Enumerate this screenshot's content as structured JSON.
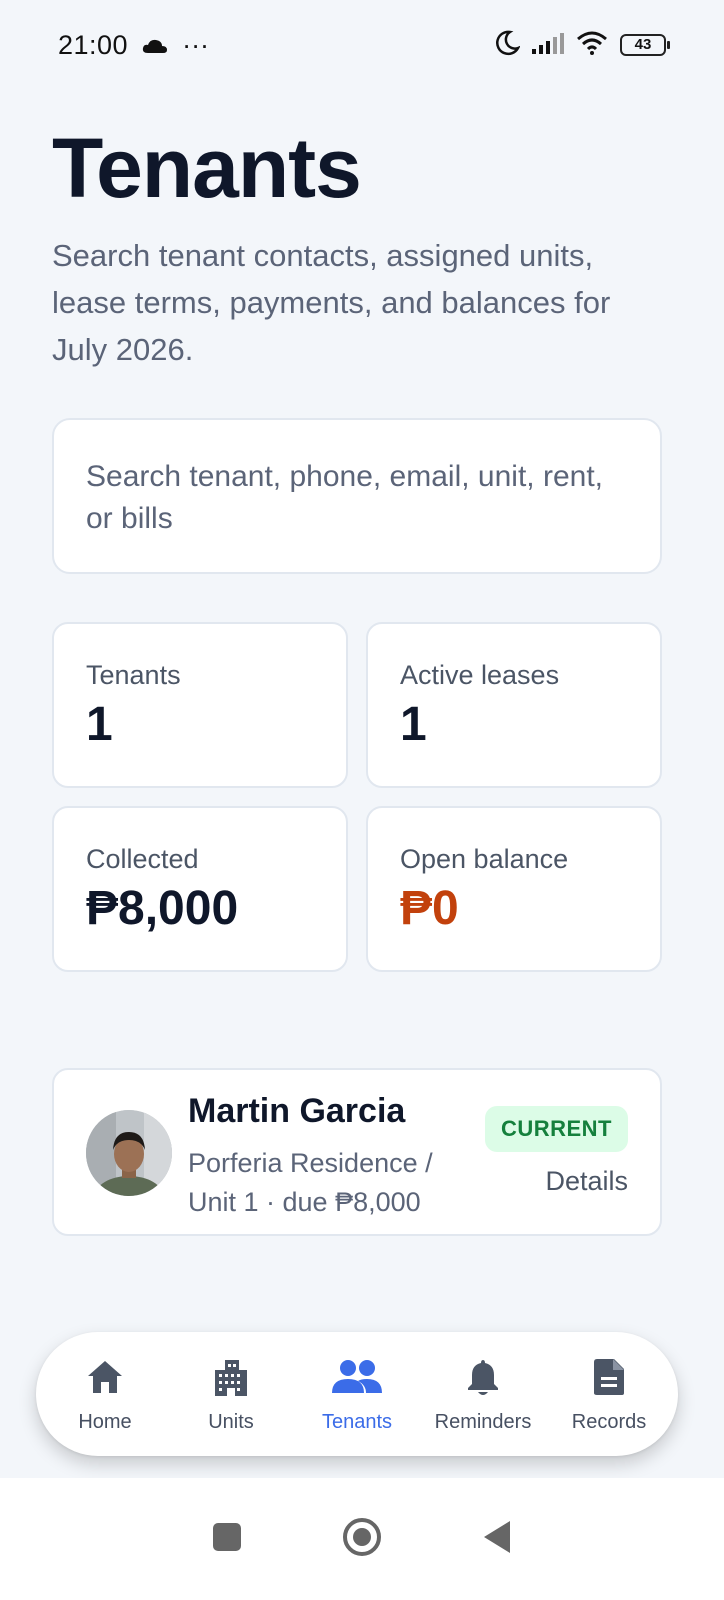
{
  "status_bar": {
    "time": "21:00",
    "dots": "···",
    "battery": "43"
  },
  "header": {
    "title": "Tenants",
    "subtitle": "Search tenant contacts, assigned units, lease terms, payments, and balances for July 2026."
  },
  "search": {
    "placeholder": "Search tenant, phone, email, unit, rent, or bills"
  },
  "stats": [
    {
      "label": "Tenants",
      "value": "1"
    },
    {
      "label": "Active leases",
      "value": "1"
    },
    {
      "label": "Collected",
      "value": "₱8,000"
    },
    {
      "label": "Open balance",
      "value": "₱0"
    }
  ],
  "tenants": [
    {
      "name": "Martin Garcia",
      "property_line": "Porferia Residence /",
      "unit_line": "Unit 1 · due ₱8,000",
      "status": "CURRENT",
      "action": "Details"
    }
  ],
  "bottom_nav": [
    {
      "label": "Home",
      "icon": "home-icon"
    },
    {
      "label": "Units",
      "icon": "building-icon"
    },
    {
      "label": "Tenants",
      "icon": "people-icon",
      "active": true
    },
    {
      "label": "Reminders",
      "icon": "bell-icon"
    },
    {
      "label": "Records",
      "icon": "document-icon"
    }
  ],
  "colors": {
    "accent": "#3b6ce8",
    "balance_warning": "#c2410c",
    "badge_bg": "#dcfce7",
    "badge_text": "#15803d"
  }
}
